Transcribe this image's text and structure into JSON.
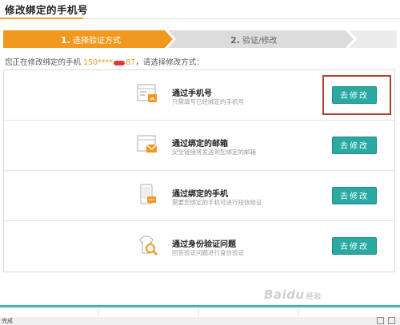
{
  "page": {
    "title": "修改绑定的手机号"
  },
  "steps": [
    {
      "number": "1.",
      "label": "选择验证方式"
    },
    {
      "number": "2.",
      "label": "验证/修改"
    }
  ],
  "intro": {
    "prefix": "您正在修改绑定的手机",
    "phone_visible_start": "150****",
    "phone_visible_end": "87",
    "suffix": "，请选择修改方式："
  },
  "options": [
    {
      "title": "通过手机号",
      "desc": "只需填写已经绑定的手机号",
      "button": "去修改",
      "icon": "phone-form-icon"
    },
    {
      "title": "通过绑定的邮箱",
      "desc": "安全链接将发送到您绑定的邮箱",
      "button": "去修改",
      "icon": "mail-icon"
    },
    {
      "title": "通过绑定的手机",
      "desc": "需要您绑定的手机可进行短信验证",
      "button": "去修改",
      "icon": "mobile-sms-icon"
    },
    {
      "title": "通过身份验证问题",
      "desc": "回答验证问题进行身份验证",
      "button": "去修改",
      "icon": "identity-search-icon"
    }
  ],
  "watermark": {
    "brand": "Baidu",
    "sub": "经验"
  },
  "statusbar": {
    "text": "完成"
  },
  "colors": {
    "accent": "#f3981f",
    "button": "#2aa9a2",
    "highlight_box": "#b73a33"
  }
}
